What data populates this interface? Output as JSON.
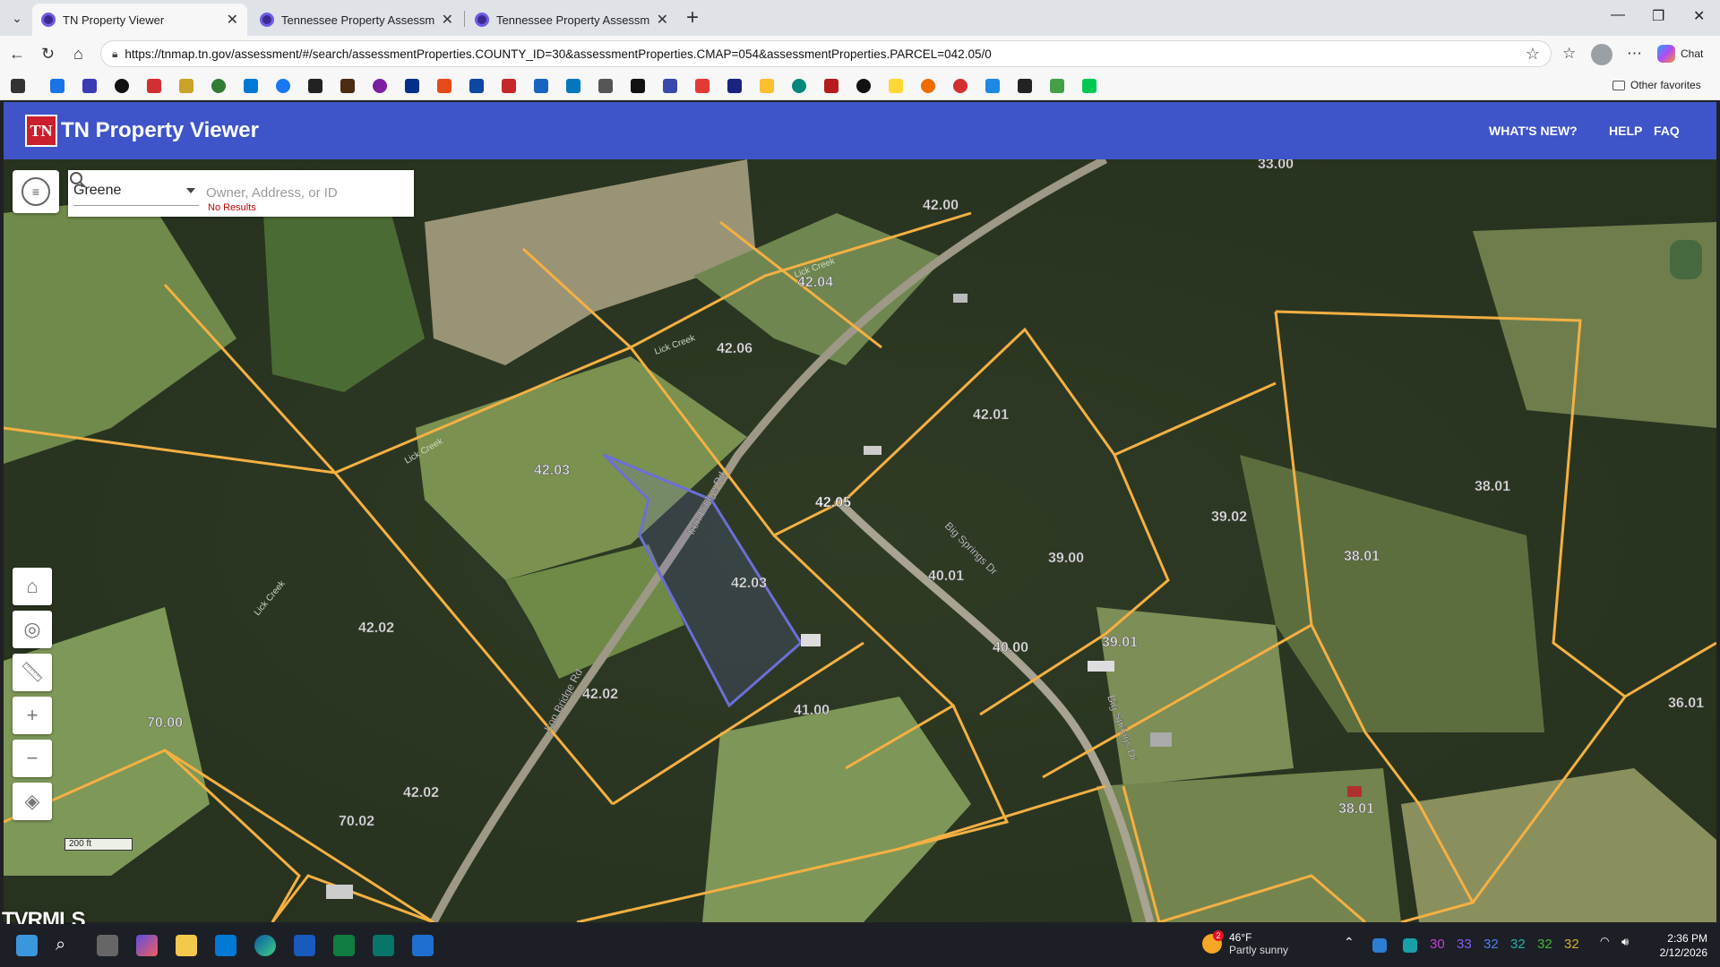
{
  "browser": {
    "tabs": [
      {
        "title": "TN Property Viewer",
        "active": true
      },
      {
        "title": "Tennessee Property Assessment D",
        "active": false
      },
      {
        "title": "Tennessee Property Assessment D",
        "active": false
      }
    ],
    "url": "https://tnmap.tn.gov/assessment/#/search/assessmentProperties.COUNTY_ID=30&assessmentProperties.CMAP=054&assessmentProperties.PARCEL=042.05/0",
    "chat_label": "Chat",
    "other_favorites": "Other favorites"
  },
  "app": {
    "logo": "TN",
    "title": "TN Property Viewer",
    "nav": [
      "WHAT'S NEW?",
      "HELP",
      "FAQ"
    ],
    "header_color": "#3f54c8"
  },
  "search": {
    "county": "Greene",
    "placeholder": "Owner, Address, or ID",
    "status": "No Results"
  },
  "map": {
    "scale": "200 ft",
    "parcel_line_color": "#f5b042",
    "selected_parcel": "42.05",
    "selected_color": "#6b6fd6",
    "parcels": [
      "33.00",
      "42.00",
      "42.04",
      "42.06",
      "42.01",
      "42.03",
      "42.05",
      "38.01",
      "39.02",
      "39.00",
      "40.01",
      "42.03",
      "42.02",
      "38.01",
      "40.00",
      "39.01",
      "42.02",
      "41.00",
      "70.00",
      "36.01",
      "42.02",
      "70.02",
      "38.01"
    ],
    "roads": [
      "Iron Bridge Rd",
      "Iron Bridge Rd",
      "Big Springs Dr",
      "Big Springs Dr"
    ],
    "creeks": [
      "Lick Creek",
      "Lick Creek",
      "Lick Creek",
      "Lick Creek"
    ]
  },
  "watermark": "TVRMLS",
  "taskbar": {
    "weather_badge": "2",
    "temperature": "46°F",
    "condition": "Partly sunny",
    "tray_numbers": [
      "30",
      "33",
      "32",
      "32",
      "32",
      "32"
    ],
    "time": "2:36 PM",
    "date": "2/12/2026"
  }
}
